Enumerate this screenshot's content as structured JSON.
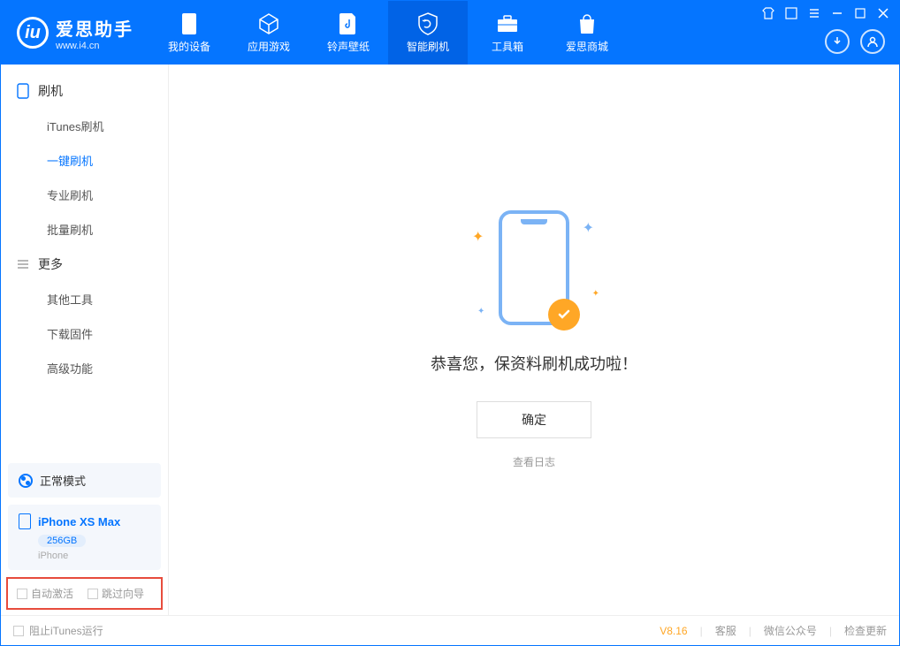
{
  "app": {
    "name": "爱思助手",
    "url": "www.i4.cn"
  },
  "nav": {
    "tabs": [
      {
        "label": "我的设备"
      },
      {
        "label": "应用游戏"
      },
      {
        "label": "铃声壁纸"
      },
      {
        "label": "智能刷机"
      },
      {
        "label": "工具箱"
      },
      {
        "label": "爱思商城"
      }
    ]
  },
  "sidebar": {
    "group1": {
      "title": "刷机",
      "items": [
        "iTunes刷机",
        "一键刷机",
        "专业刷机",
        "批量刷机"
      ]
    },
    "group2": {
      "title": "更多",
      "items": [
        "其他工具",
        "下载固件",
        "高级功能"
      ]
    },
    "mode_label": "正常模式",
    "device": {
      "name": "iPhone XS Max",
      "storage": "256GB",
      "type": "iPhone"
    },
    "checks": {
      "auto_activate": "自动激活",
      "skip_guide": "跳过向导"
    }
  },
  "main": {
    "success_msg": "恭喜您，保资料刷机成功啦！",
    "ok_button": "确定",
    "log_link": "查看日志"
  },
  "footer": {
    "block_itunes": "阻止iTunes运行",
    "version": "V8.16",
    "links": [
      "客服",
      "微信公众号",
      "检查更新"
    ]
  }
}
